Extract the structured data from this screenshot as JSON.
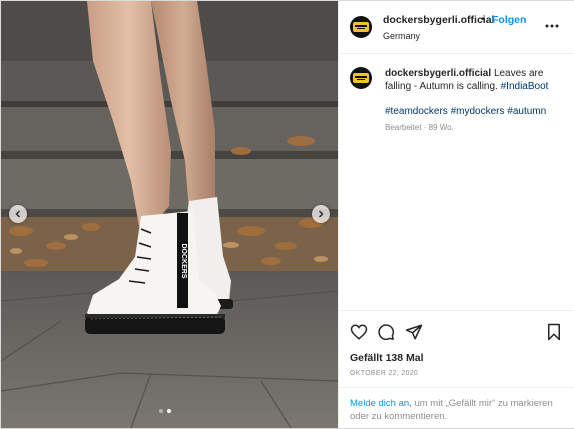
{
  "post": {
    "username": "dockersbygerli.official",
    "separator": "•",
    "follow_label": "Folgen",
    "location": "Germany",
    "more_label": "•••",
    "caption_text": "Leaves are falling - Autumn is calling.",
    "hashtags_line1": [
      "#IndiaBoot"
    ],
    "hashtags_line2": [
      "#teamdockers",
      "#mydockers",
      "#autumn"
    ],
    "edited_label": "Bearbeitet · 89 Wo.",
    "likes_label": "Gefällt 138 Mal",
    "date_label": "OKTOBER 22, 2020",
    "login_link": "Melde dich an,",
    "login_rest": "um mit „Gefällt mir“ zu markieren oder zu kommentieren."
  },
  "media": {
    "slide_count": 2,
    "active_slide": 2,
    "boot_strap_text": "DOCKERS"
  },
  "icons": {
    "like": "heart-icon",
    "comment": "comment-icon",
    "share": "paper-plane-icon",
    "save": "bookmark-icon",
    "prev": "chevron-left-icon",
    "next": "chevron-right-icon"
  },
  "colors": {
    "link_blue": "#0095f6",
    "hashtag_blue": "#00376b",
    "muted_gray": "#8e8e8e",
    "text_dark": "#262626"
  }
}
